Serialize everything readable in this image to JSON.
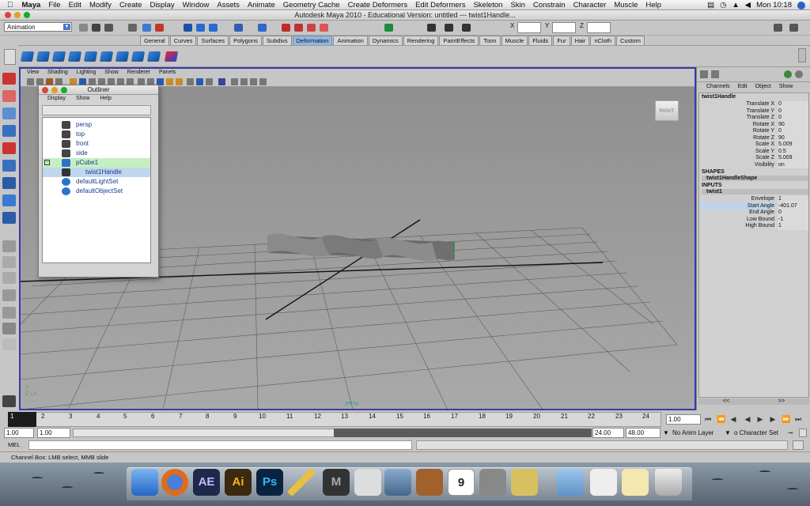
{
  "mac_menubar": {
    "app": "Maya",
    "items": [
      "File",
      "Edit",
      "Modify",
      "Create",
      "Display",
      "Window",
      "Assets",
      "Animate",
      "Geometry Cache",
      "Create Deformers",
      "Edit Deformers",
      "Skeleton",
      "Skin",
      "Constrain",
      "Character",
      "Muscle",
      "Help"
    ],
    "clock": "Mon 10:18"
  },
  "window": {
    "title": "Autodesk Maya 2010 - Educational Version: untitled   ---   twist1Handle..."
  },
  "status_line": {
    "mode": "Animation",
    "x_label": "X",
    "y_label": "Y",
    "z_label": "Z"
  },
  "shelf_tabs": [
    "General",
    "Curves",
    "Surfaces",
    "Polygons",
    "Subdivs",
    "Deformation",
    "Animation",
    "Dynamics",
    "Rendering",
    "PaintEffects",
    "Toon",
    "Muscle",
    "Fluids",
    "Fur",
    "Hair",
    "nCloth",
    "Custom"
  ],
  "active_shelf": "Deformation",
  "viewport": {
    "menu": [
      "View",
      "Shading",
      "Lighting",
      "Show",
      "Renderer",
      "Panels"
    ],
    "camera": "persp",
    "viewcube_label": "RIGHT"
  },
  "outliner": {
    "title": "Outliner",
    "menu": [
      "Display",
      "Show",
      "Help"
    ],
    "items": [
      {
        "label": "persp",
        "icon": "camera-icon"
      },
      {
        "label": "top",
        "icon": "camera-icon"
      },
      {
        "label": "front",
        "icon": "camera-icon"
      },
      {
        "label": "side",
        "icon": "camera-icon"
      },
      {
        "label": "pCube1",
        "icon": "mesh-icon"
      },
      {
        "label": "twist1Handle",
        "icon": "deformer-handle-icon"
      },
      {
        "label": "defaultLightSet",
        "icon": "set-icon"
      },
      {
        "label": "defaultObjectSet",
        "icon": "set-icon"
      }
    ]
  },
  "channel_box": {
    "menu": [
      "Channels",
      "Edit",
      "Object",
      "Show"
    ],
    "object": "twist1Handle",
    "attributes": [
      {
        "name": "Translate X",
        "value": "0"
      },
      {
        "name": "Translate Y",
        "value": "0"
      },
      {
        "name": "Translate Z",
        "value": "0"
      },
      {
        "name": "Rotate X",
        "value": "90"
      },
      {
        "name": "Rotate Y",
        "value": "0"
      },
      {
        "name": "Rotate Z",
        "value": "90"
      },
      {
        "name": "Scale X",
        "value": "5.009"
      },
      {
        "name": "Scale Y",
        "value": "0.5"
      },
      {
        "name": "Scale Z",
        "value": "5.009"
      },
      {
        "name": "Visibility",
        "value": "on"
      }
    ],
    "shapes_label": "SHAPES",
    "shape": "twist1HandleShape",
    "inputs_label": "INPUTS",
    "input": "twist1",
    "input_attributes": [
      {
        "name": "Envelope",
        "value": "1"
      },
      {
        "name": "Start Angle",
        "value": "-401.07"
      },
      {
        "name": "End Angle",
        "value": "0"
      },
      {
        "name": "Low Bound",
        "value": "-1"
      },
      {
        "name": "High Bound",
        "value": "1"
      }
    ],
    "scroll_left": "<<",
    "scroll_right": ">>"
  },
  "time_slider": {
    "current_frame": "1",
    "ticks": [
      "2",
      "3",
      "4",
      "5",
      "6",
      "7",
      "8",
      "9",
      "10",
      "11",
      "12",
      "13",
      "14",
      "15",
      "16",
      "17",
      "18",
      "19",
      "20",
      "21",
      "22",
      "23",
      "24"
    ],
    "current_time": "1.00"
  },
  "range_slider": {
    "start": "1.00",
    "range_start": "1.00",
    "range_end": "24.00",
    "end": "48.00",
    "anim_layer": "No Anim Layer",
    "character_set": "o Character Set"
  },
  "command_line": {
    "label": "MEL"
  },
  "help_line": "Channel Box: LMB select, MMB slide",
  "dock": {
    "apps": [
      "Finder",
      "Firefox",
      "AE",
      "Ai",
      "Ps",
      "Pencil",
      "Maya",
      "Photo Booth",
      "iPhoto",
      "GarageBand",
      "iCal",
      "System Preferences",
      "Keychain",
      "Folder",
      "Documents",
      "Finder Window",
      "Trash"
    ],
    "calendar_day": "9"
  }
}
